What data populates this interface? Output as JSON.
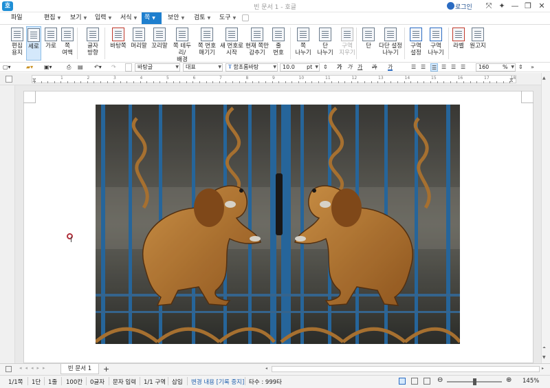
{
  "window": {
    "title": "빈 문서 1 - 호글",
    "app_icon": "호",
    "login_label": "로그인",
    "controls": [
      "⤧",
      "✦",
      "—",
      "❐",
      "✕"
    ]
  },
  "menubar": {
    "file": "파일",
    "items": [
      "편집",
      "보기",
      "입력",
      "서식",
      "쪽",
      "보안",
      "검토",
      "도구"
    ],
    "active": "쪽"
  },
  "ribbon": {
    "buttons": [
      {
        "label": "편집\n용지"
      },
      {
        "label": "세로",
        "selected": true
      },
      {
        "label": "가로"
      },
      {
        "label": "쪽\n여백"
      },
      {
        "label": "글자\n방향"
      },
      {
        "label": "바탕쪽"
      },
      {
        "label": "머리말"
      },
      {
        "label": "꼬리말"
      },
      {
        "label": "쪽 테두리/\n배경"
      },
      {
        "label": "쪽 번호\n매기기"
      },
      {
        "label": "새 번호로\n시작"
      },
      {
        "label": "현재 쪽만\n감추기"
      },
      {
        "label": "줄\n번호"
      },
      {
        "label": "쪽\n나누기"
      },
      {
        "label": "단\n나누기"
      },
      {
        "label": "구역\n지우기",
        "disabled": true
      },
      {
        "label": "단"
      },
      {
        "label": "다단 설정\n나누기"
      },
      {
        "label": "구역\n설정"
      },
      {
        "label": "구역\n나누기"
      },
      {
        "label": "라벨"
      },
      {
        "label": "원고지"
      }
    ]
  },
  "format_toolbar": {
    "style": "바탕글",
    "lang": "대표",
    "font": "함초롬바탕",
    "size": "10.0",
    "size_unit": "pt",
    "bold": "가",
    "italic": "가",
    "underline": "가",
    "strike": "가",
    "color": "가",
    "line_spacing": "160",
    "line_spacing_unit": "%"
  },
  "ruler": {
    "numbers": [
      "1",
      "2",
      "3",
      "4",
      "5",
      "6",
      "7",
      "8",
      "9",
      "10",
      "11",
      "12",
      "13",
      "14",
      "15",
      "16",
      "17",
      "18"
    ]
  },
  "tabs": {
    "doc_tab": "빈 문서 1",
    "add": "+"
  },
  "statusbar": {
    "page": "1/1쪽",
    "column": "1단",
    "line": "1줄",
    "col": "100칸",
    "chars": "0글자",
    "mode": "문자 입력",
    "section": "1/1 구역",
    "insert": "삽입",
    "track": "변경 내용 [기록 중지]",
    "typing": "타수 : 999타",
    "zoom": "145%"
  },
  "colors": {
    "accent": "#1e7fce",
    "selected_button": "#d4e8fb",
    "cursor_icon": "#b0303c",
    "gate_blue": "#2a6ea8",
    "lion_gold": "#c07d32"
  }
}
